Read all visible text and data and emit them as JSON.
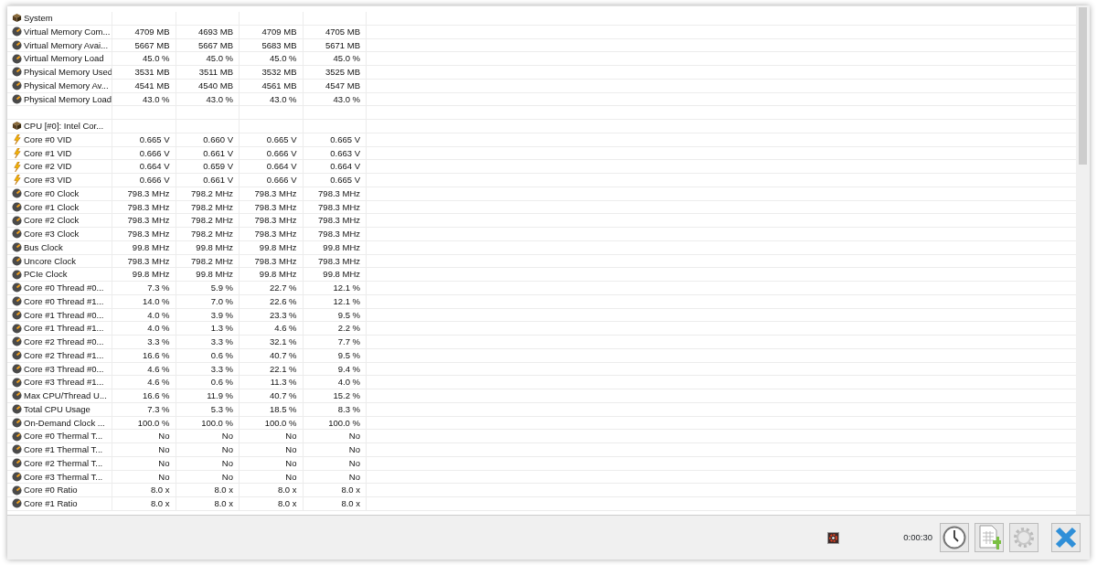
{
  "rows": [
    {
      "kind": "group",
      "label": "System",
      "values": []
    },
    {
      "kind": "sensor",
      "label": "Virtual Memory Com...",
      "values": [
        "4709 MB",
        "4693 MB",
        "4709 MB",
        "4705 MB"
      ]
    },
    {
      "kind": "sensor",
      "label": "Virtual Memory Avai...",
      "values": [
        "5667 MB",
        "5667 MB",
        "5683 MB",
        "5671 MB"
      ]
    },
    {
      "kind": "sensor",
      "label": "Virtual Memory Load",
      "values": [
        "45.0 %",
        "45.0 %",
        "45.0 %",
        "45.0 %"
      ]
    },
    {
      "kind": "sensor",
      "label": "Physical Memory Used",
      "values": [
        "3531 MB",
        "3511 MB",
        "3532 MB",
        "3525 MB"
      ]
    },
    {
      "kind": "sensor",
      "label": "Physical Memory Av...",
      "values": [
        "4541 MB",
        "4540 MB",
        "4561 MB",
        "4547 MB"
      ]
    },
    {
      "kind": "sensor",
      "label": "Physical Memory Load",
      "values": [
        "43.0 %",
        "43.0 %",
        "43.0 %",
        "43.0 %"
      ]
    },
    {
      "kind": "blank",
      "values": []
    },
    {
      "kind": "group",
      "label": "CPU [#0]: Intel Cor...",
      "values": []
    },
    {
      "kind": "voltage",
      "label": "Core #0 VID",
      "values": [
        "0.665 V",
        "0.660 V",
        "0.665 V",
        "0.665 V"
      ]
    },
    {
      "kind": "voltage",
      "label": "Core #1 VID",
      "values": [
        "0.666 V",
        "0.661 V",
        "0.666 V",
        "0.663 V"
      ]
    },
    {
      "kind": "voltage",
      "label": "Core #2 VID",
      "values": [
        "0.664 V",
        "0.659 V",
        "0.664 V",
        "0.664 V"
      ]
    },
    {
      "kind": "voltage",
      "label": "Core #3 VID",
      "values": [
        "0.666 V",
        "0.661 V",
        "0.666 V",
        "0.665 V"
      ]
    },
    {
      "kind": "sensor",
      "label": "Core #0 Clock",
      "values": [
        "798.3 MHz",
        "798.2 MHz",
        "798.3 MHz",
        "798.3 MHz"
      ]
    },
    {
      "kind": "sensor",
      "label": "Core #1 Clock",
      "values": [
        "798.3 MHz",
        "798.2 MHz",
        "798.3 MHz",
        "798.3 MHz"
      ]
    },
    {
      "kind": "sensor",
      "label": "Core #2 Clock",
      "values": [
        "798.3 MHz",
        "798.2 MHz",
        "798.3 MHz",
        "798.3 MHz"
      ]
    },
    {
      "kind": "sensor",
      "label": "Core #3 Clock",
      "values": [
        "798.3 MHz",
        "798.2 MHz",
        "798.3 MHz",
        "798.3 MHz"
      ]
    },
    {
      "kind": "sensor",
      "label": "Bus Clock",
      "values": [
        "99.8 MHz",
        "99.8 MHz",
        "99.8 MHz",
        "99.8 MHz"
      ]
    },
    {
      "kind": "sensor",
      "label": "Uncore Clock",
      "values": [
        "798.3 MHz",
        "798.2 MHz",
        "798.3 MHz",
        "798.3 MHz"
      ]
    },
    {
      "kind": "sensor",
      "label": "PCIe Clock",
      "values": [
        "99.8 MHz",
        "99.8 MHz",
        "99.8 MHz",
        "99.8 MHz"
      ]
    },
    {
      "kind": "sensor",
      "label": "Core #0 Thread #0...",
      "values": [
        "7.3 %",
        "5.9 %",
        "22.7 %",
        "12.1 %"
      ]
    },
    {
      "kind": "sensor",
      "label": "Core #0 Thread #1...",
      "values": [
        "14.0 %",
        "7.0 %",
        "22.6 %",
        "12.1 %"
      ]
    },
    {
      "kind": "sensor",
      "label": "Core #1 Thread #0...",
      "values": [
        "4.0 %",
        "3.9 %",
        "23.3 %",
        "9.5 %"
      ]
    },
    {
      "kind": "sensor",
      "label": "Core #1 Thread #1...",
      "values": [
        "4.0 %",
        "1.3 %",
        "4.6 %",
        "2.2 %"
      ]
    },
    {
      "kind": "sensor",
      "label": "Core #2 Thread #0...",
      "values": [
        "3.3 %",
        "3.3 %",
        "32.1 %",
        "7.7 %"
      ]
    },
    {
      "kind": "sensor",
      "label": "Core #2 Thread #1...",
      "values": [
        "16.6 %",
        "0.6 %",
        "40.7 %",
        "9.5 %"
      ]
    },
    {
      "kind": "sensor",
      "label": "Core #3 Thread #0...",
      "values": [
        "4.6 %",
        "3.3 %",
        "22.1 %",
        "9.4 %"
      ]
    },
    {
      "kind": "sensor",
      "label": "Core #3 Thread #1...",
      "values": [
        "4.6 %",
        "0.6 %",
        "11.3 %",
        "4.0 %"
      ]
    },
    {
      "kind": "sensor",
      "label": "Max CPU/Thread U...",
      "values": [
        "16.6 %",
        "11.9 %",
        "40.7 %",
        "15.2 %"
      ]
    },
    {
      "kind": "sensor",
      "label": "Total CPU Usage",
      "values": [
        "7.3 %",
        "5.3 %",
        "18.5 %",
        "8.3 %"
      ]
    },
    {
      "kind": "sensor",
      "label": "On-Demand Clock ...",
      "values": [
        "100.0 %",
        "100.0 %",
        "100.0 %",
        "100.0 %"
      ]
    },
    {
      "kind": "sensor",
      "label": "Core #0 Thermal T...",
      "values": [
        "No",
        "No",
        "No",
        "No"
      ]
    },
    {
      "kind": "sensor",
      "label": "Core #1 Thermal T...",
      "values": [
        "No",
        "No",
        "No",
        "No"
      ]
    },
    {
      "kind": "sensor",
      "label": "Core #2 Thermal T...",
      "values": [
        "No",
        "No",
        "No",
        "No"
      ]
    },
    {
      "kind": "sensor",
      "label": "Core #3 Thermal T...",
      "values": [
        "No",
        "No",
        "No",
        "No"
      ]
    },
    {
      "kind": "sensor",
      "label": "Core #0 Ratio",
      "values": [
        "8.0 x",
        "8.0 x",
        "8.0 x",
        "8.0 x"
      ]
    },
    {
      "kind": "sensor",
      "label": "Core #1 Ratio",
      "values": [
        "8.0 x",
        "8.0 x",
        "8.0 x",
        "8.0 x"
      ]
    }
  ],
  "toolbar": {
    "timer": "0:00:30"
  }
}
